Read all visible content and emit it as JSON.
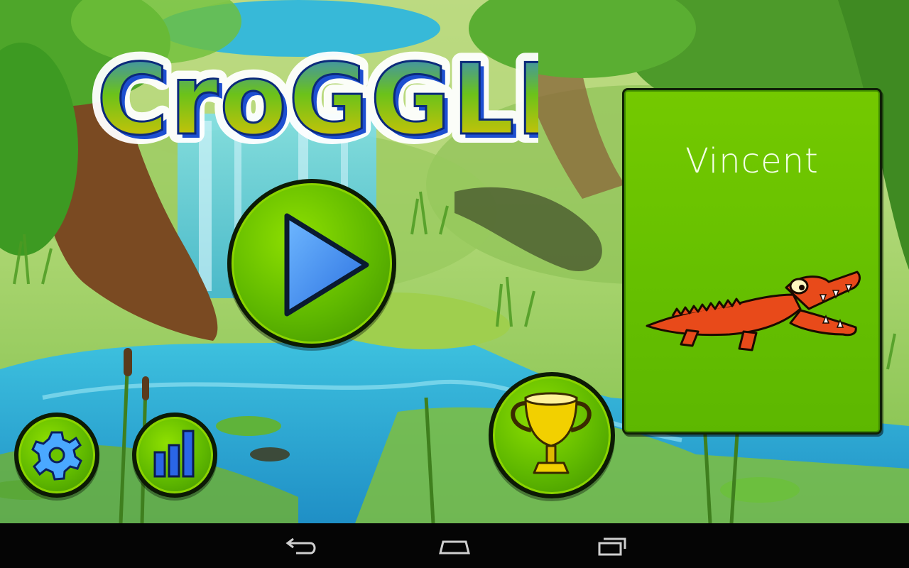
{
  "app": {
    "title": "CroGGLE"
  },
  "character": {
    "name": "Vincent",
    "accent_color": "#e84a1a"
  },
  "buttons": {
    "play_icon": "play-icon",
    "trophy_icon": "trophy-icon",
    "settings_icon": "gear-icon",
    "stats_icon": "bar-chart-icon"
  },
  "navbar": {
    "back_icon": "back-icon",
    "home_icon": "home-icon",
    "recents_icon": "recents-icon"
  },
  "colors": {
    "button_green": "#5fb800",
    "card_green": "#6cc400",
    "accent_blue": "#3a8cf0",
    "trophy_gold": "#f2d000"
  }
}
